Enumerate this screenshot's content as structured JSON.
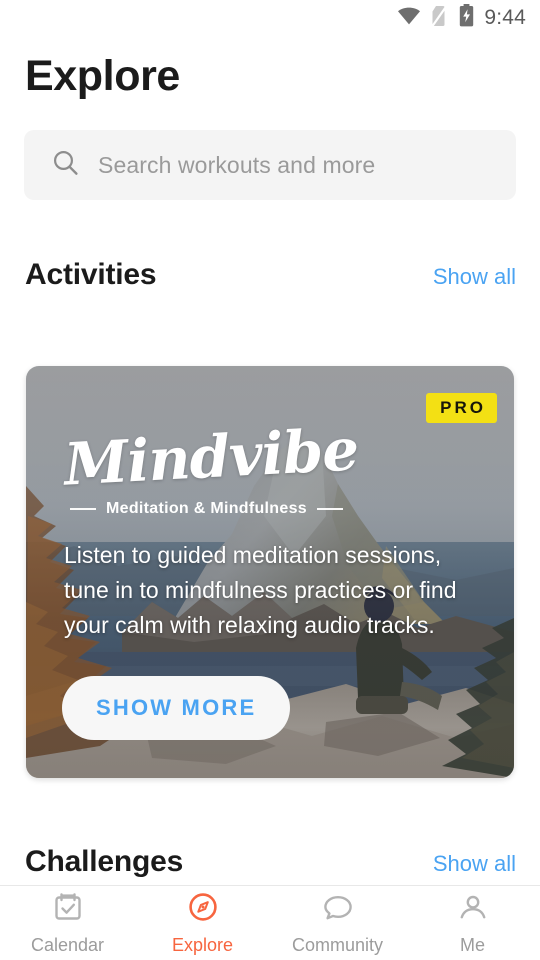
{
  "statusbar": {
    "time": "9:44",
    "icons": [
      "wifi-icon",
      "sim-off-icon",
      "battery-charging-icon"
    ]
  },
  "header": {
    "title": "Explore"
  },
  "search": {
    "placeholder": "Search workouts and more",
    "value": "",
    "icon": "search-icon"
  },
  "sections": [
    {
      "title": "Activities",
      "show_all_label": "Show all"
    },
    {
      "title": "Challenges",
      "show_all_label": "Show all"
    }
  ],
  "activity_card": {
    "badge": "PRO",
    "brand_name": "Mindvibe",
    "brand_tagline": "Meditation & Mindfulness",
    "description": "Listen to guided meditation sessions, tune in to mindfulness practices or find your calm with relaxing audio tracks.",
    "cta_label": "SHOW MORE"
  },
  "bottom_nav": [
    {
      "label": "Calendar",
      "icon": "calendar-check-icon",
      "active": false
    },
    {
      "label": "Explore",
      "icon": "compass-icon",
      "active": true
    },
    {
      "label": "Community",
      "icon": "chat-bubble-icon",
      "active": false
    },
    {
      "label": "Me",
      "icon": "person-icon",
      "active": false
    }
  ],
  "colors": {
    "accent_orange": "#f7653f",
    "link_blue": "#4aa3f2",
    "pro_yellow": "#f3e014",
    "text_dark": "#1b1b1b",
    "text_muted": "#9a9a9a",
    "search_bg": "#f4f4f4"
  }
}
